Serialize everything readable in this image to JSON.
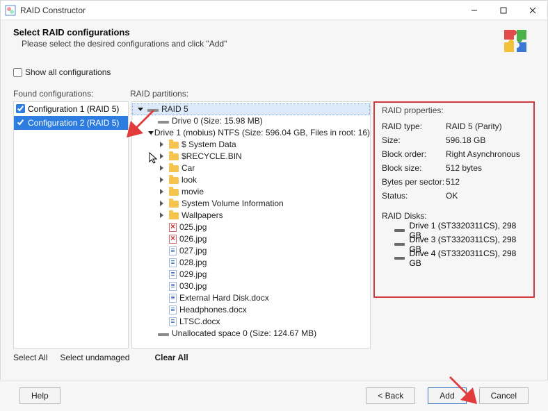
{
  "window": {
    "title": "RAID Constructor"
  },
  "header": {
    "title": "Select RAID configurations",
    "subtitle": "Please select the desired configurations and click \"Add\""
  },
  "show_all": {
    "label": "Show all configurations"
  },
  "labels": {
    "found": "Found configurations:",
    "partitions": "RAID partitions:",
    "properties": "RAID properties:"
  },
  "configs": [
    {
      "label": "Configuration 1 (RAID 5)",
      "checked": true,
      "selected": false
    },
    {
      "label": "Configuration 2 (RAID 5)",
      "checked": true,
      "selected": true
    }
  ],
  "tree": {
    "root": "RAID 5",
    "drive0": "Drive 0 (Size: 15.98 MB)",
    "drive1": "Drive 1 (mobius) NTFS (Size: 596.04 GB, Files in root: 16)",
    "folders": [
      "$ System Data",
      "$RECYCLE.BIN",
      "Car",
      "look",
      "movie",
      "System Volume Information",
      "Wallpapers"
    ],
    "files": [
      "025.jpg",
      "026.jpg",
      "027.jpg",
      "028.jpg",
      "029.jpg",
      "030.jpg",
      "External Hard Disk.docx",
      "Headphones.docx",
      "LTSC.docx"
    ],
    "unalloc": "Unallocated space 0 (Size: 124.67 MB)"
  },
  "props": {
    "rows": [
      {
        "k": "RAID type:",
        "v": "RAID 5 (Parity)"
      },
      {
        "k": "Size:",
        "v": "596.18 GB"
      },
      {
        "k": "Block order:",
        "v": "Right Asynchronous"
      },
      {
        "k": "Block size:",
        "v": "512 bytes"
      },
      {
        "k": "Bytes per sector:",
        "v": "512"
      },
      {
        "k": "Status:",
        "v": "OK"
      }
    ],
    "disks_label": "RAID Disks:",
    "disks": [
      "Drive 1 (ST3320311CS), 298 GB",
      "Drive 3 (ST3320311CS), 298 GB",
      "Drive 4 (ST3320311CS), 298 GB"
    ]
  },
  "actions": {
    "select_all": "Select All",
    "select_undamaged": "Select undamaged",
    "clear_all": "Clear All"
  },
  "footer": {
    "help": "Help",
    "back": "< Back",
    "add": "Add",
    "cancel": "Cancel"
  }
}
